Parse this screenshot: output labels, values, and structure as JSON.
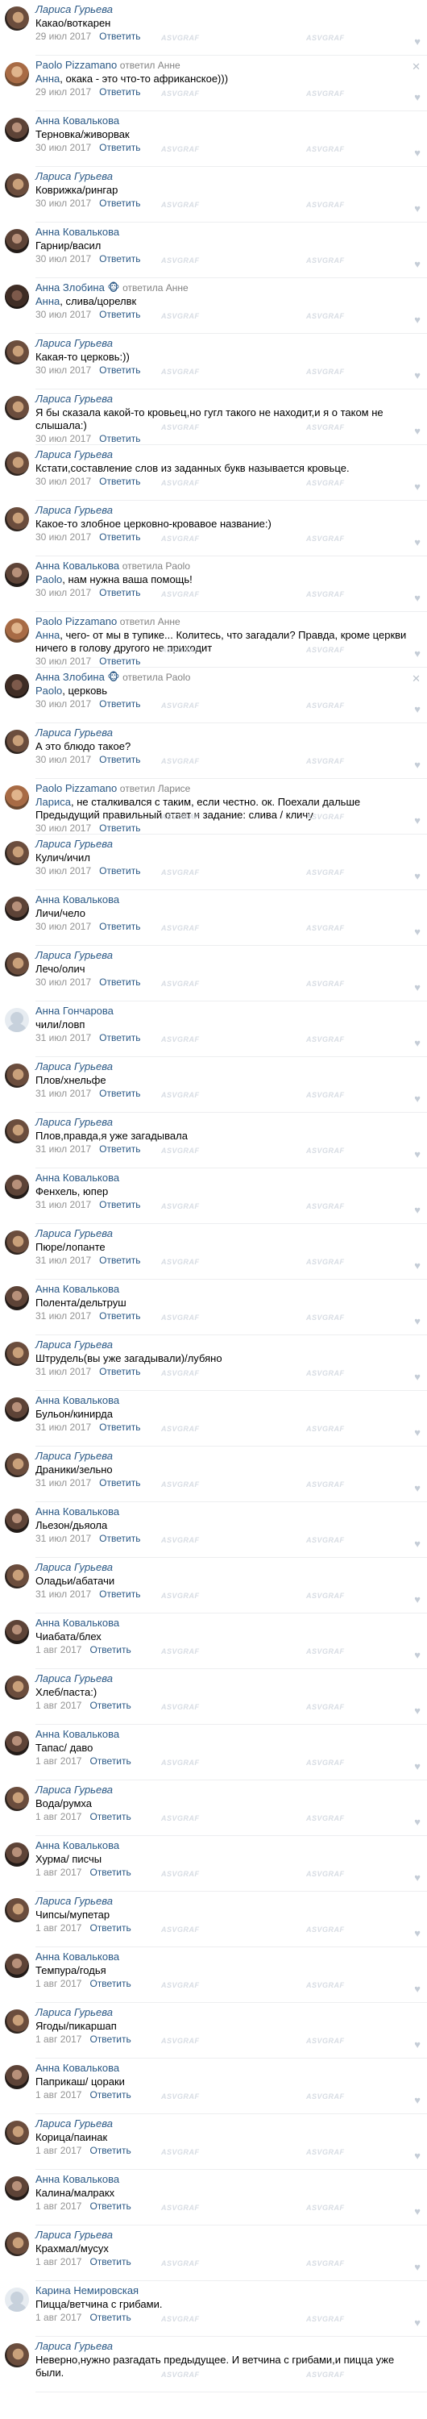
{
  "comments": [
    {
      "author": "Лариса Гурьева",
      "avatar": "larisa",
      "text": "Какао/воткарен",
      "date": "29 июл 2017",
      "reply": "Ответить"
    },
    {
      "author": "Paolo Pizzamano",
      "reply_to": "ответил Анне",
      "avatar": "paolo",
      "mention": "Анна",
      "text": ", окака - это что-то африканское)))",
      "date": "29 июл 2017",
      "reply": "Ответить",
      "removable": true
    },
    {
      "author": "Анна Ковалькова",
      "avatar": "anna-k",
      "text": "Терновка/живорвак",
      "date": "30 июл 2017",
      "reply": "Ответить"
    },
    {
      "author": "Лариса Гурьева",
      "avatar": "larisa",
      "text": "Коврижка/рингар",
      "date": "30 июл 2017",
      "reply": "Ответить"
    },
    {
      "author": "Анна Ковалькова",
      "avatar": "anna-k",
      "text": "Гарнир/васил",
      "date": "30 июл 2017",
      "reply": "Ответить"
    },
    {
      "author": "Анна Злобина 🐵",
      "reply_to": "ответила Анне",
      "avatar": "anna-z",
      "mention": "Анна",
      "text": ", слива/цорелвк",
      "date": "30 июл 2017",
      "reply": "Ответить"
    },
    {
      "author": "Лариса Гурьева",
      "avatar": "larisa",
      "text": "Какая-то церковь:))",
      "date": "30 июл 2017",
      "reply": "Ответить"
    },
    {
      "author": "Лариса Гурьева",
      "avatar": "larisa",
      "text": "Я бы сказала какой-то кровьец,но гугл такого не находит,и я о таком не слышала:)",
      "date": "30 июл 2017",
      "reply": "Ответить"
    },
    {
      "author": "Лариса Гурьева",
      "avatar": "larisa",
      "text": "Кстати,составление слов из заданных букв называется кровьце.",
      "date": "30 июл 2017",
      "reply": "Ответить"
    },
    {
      "author": "Лариса Гурьева",
      "avatar": "larisa",
      "text": "Какое-то злобное церковно-кровавое название:)",
      "date": "30 июл 2017",
      "reply": "Ответить"
    },
    {
      "author": "Анна Ковалькова",
      "reply_to": "ответила Paolo",
      "avatar": "anna-k",
      "mention": "Paolo",
      "text": ", нам нужна ваша помощь!",
      "date": "30 июл 2017",
      "reply": "Ответить"
    },
    {
      "author": "Paolo Pizzamano",
      "reply_to": "ответил Анне",
      "avatar": "paolo",
      "mention": "Анна",
      "text": ", чего- от мы в тупике... Колитесь, что загадали? Правда, кроме церкви ничего в голову другого не приходит",
      "date": "30 июл 2017",
      "reply": "Ответить"
    },
    {
      "author": "Анна Злобина 🐵",
      "reply_to": "ответила Paolo",
      "avatar": "anna-z",
      "mention": "Paolo",
      "text": ", церковь",
      "date": "30 июл 2017",
      "reply": "Ответить",
      "removable": true
    },
    {
      "author": "Лариса Гурьева",
      "avatar": "larisa",
      "text": "А это блюдо такое?",
      "date": "30 июл 2017",
      "reply": "Ответить"
    },
    {
      "author": "Paolo Pizzamano",
      "reply_to": "ответил Ларисе",
      "avatar": "paolo",
      "mention": "Лариса",
      "text": ", не сталкивался с таким, если честно. ок. Поехали дальше Предыдущий правильный ответ и задание: слива / кличу",
      "date": "30 июл 2017",
      "reply": "Ответить"
    },
    {
      "author": "Лариса Гурьева",
      "avatar": "larisa",
      "text": "Кулич/ичил",
      "date": "30 июл 2017",
      "reply": "Ответить"
    },
    {
      "author": "Анна Ковалькова",
      "avatar": "anna-k",
      "text": "Личи/чело",
      "date": "30 июл 2017",
      "reply": "Ответить"
    },
    {
      "author": "Лариса Гурьева",
      "avatar": "larisa",
      "text": "Лечо/олич",
      "date": "30 июл 2017",
      "reply": "Ответить"
    },
    {
      "author": "Анна Гончарова",
      "avatar": "anna-g",
      "text": "чили/ловп",
      "date": "31 июл 2017",
      "reply": "Ответить"
    },
    {
      "author": "Лариса Гурьева",
      "avatar": "larisa",
      "text": "Плов/хнельфе",
      "date": "31 июл 2017",
      "reply": "Ответить"
    },
    {
      "author": "Лариса Гурьева",
      "avatar": "larisa",
      "text": "Плов,правда,я уже загадывала",
      "date": "31 июл 2017",
      "reply": "Ответить"
    },
    {
      "author": "Анна Ковалькова",
      "avatar": "anna-k",
      "text": "Фенхель, юпер",
      "date": "31 июл 2017",
      "reply": "Ответить"
    },
    {
      "author": "Лариса Гурьева",
      "avatar": "larisa",
      "text": "Пюре/лопанте",
      "date": "31 июл 2017",
      "reply": "Ответить"
    },
    {
      "author": "Анна Ковалькова",
      "avatar": "anna-k",
      "text": "Полента/дельтруш",
      "date": "31 июл 2017",
      "reply": "Ответить"
    },
    {
      "author": "Лариса Гурьева",
      "avatar": "larisa",
      "text": "Штрудель(вы уже загадывали)/лубяно",
      "date": "31 июл 2017",
      "reply": "Ответить"
    },
    {
      "author": "Анна Ковалькова",
      "avatar": "anna-k",
      "text": "Бульон/кинирда",
      "date": "31 июл 2017",
      "reply": "Ответить"
    },
    {
      "author": "Лариса Гурьева",
      "avatar": "larisa",
      "text": "Драники/зельно",
      "date": "31 июл 2017",
      "reply": "Ответить"
    },
    {
      "author": "Анна Ковалькова",
      "avatar": "anna-k",
      "text": "Льезон/дьяола",
      "date": "31 июл 2017",
      "reply": "Ответить"
    },
    {
      "author": "Лариса Гурьева",
      "avatar": "larisa",
      "text": "Оладьи/абатачи",
      "date": "31 июл 2017",
      "reply": "Ответить"
    },
    {
      "author": "Анна Ковалькова",
      "avatar": "anna-k",
      "text": "Чиабата/блех",
      "date": "1 авг 2017",
      "reply": "Ответить"
    },
    {
      "author": "Лариса Гурьева",
      "avatar": "larisa",
      "text": "Хлеб/паста:)",
      "date": "1 авг 2017",
      "reply": "Ответить"
    },
    {
      "author": "Анна Ковалькова",
      "avatar": "anna-k",
      "text": "Тапас/ даво",
      "date": "1 авг 2017",
      "reply": "Ответить"
    },
    {
      "author": "Лариса Гурьева",
      "avatar": "larisa",
      "text": "Вода/румха",
      "date": "1 авг 2017",
      "reply": "Ответить"
    },
    {
      "author": "Анна Ковалькова",
      "avatar": "anna-k",
      "text": "Хурма/ писчы",
      "date": "1 авг 2017",
      "reply": "Ответить"
    },
    {
      "author": "Лариса Гурьева",
      "avatar": "larisa",
      "text": "Чипсы/мупетар",
      "date": "1 авг 2017",
      "reply": "Ответить"
    },
    {
      "author": "Анна Ковалькова",
      "avatar": "anna-k",
      "text": "Темпура/годья",
      "date": "1 авг 2017",
      "reply": "Ответить"
    },
    {
      "author": "Лариса Гурьева",
      "avatar": "larisa",
      "text": "Ягоды/пикаршап",
      "date": "1 авг 2017",
      "reply": "Ответить"
    },
    {
      "author": "Анна Ковалькова",
      "avatar": "anna-k",
      "text": "Паприкаш/ цораки",
      "date": "1 авг 2017",
      "reply": "Ответить"
    },
    {
      "author": "Лариса Гурьева",
      "avatar": "larisa",
      "text": "Корица/паинак",
      "date": "1 авг 2017",
      "reply": "Ответить"
    },
    {
      "author": "Анна Ковалькова",
      "avatar": "anna-k",
      "text": "Калина/малракх",
      "date": "1 авг 2017",
      "reply": "Ответить"
    },
    {
      "author": "Лариса Гурьева",
      "avatar": "larisa",
      "text": "Крахмал/мусух",
      "date": "1 авг 2017",
      "reply": "Ответить"
    },
    {
      "author": "Карина Немировская",
      "avatar": "karina",
      "text": "Пицца/ветчина с грибами.",
      "date": "1 авг 2017",
      "reply": "Ответить"
    },
    {
      "author": "Лариса Гурьева",
      "avatar": "larisa",
      "text": "Неверно,нужно разгадать предыдущее. И ветчина с грибами,и пицца уже были.",
      "date": "",
      "reply": ""
    }
  ],
  "watermark": "ASVGRAF",
  "like_icon": "heart-icon",
  "remove_icon": "close-icon",
  "colors": {
    "link": "#2a5885",
    "meta": "#939393",
    "separator": "#edeef0"
  }
}
